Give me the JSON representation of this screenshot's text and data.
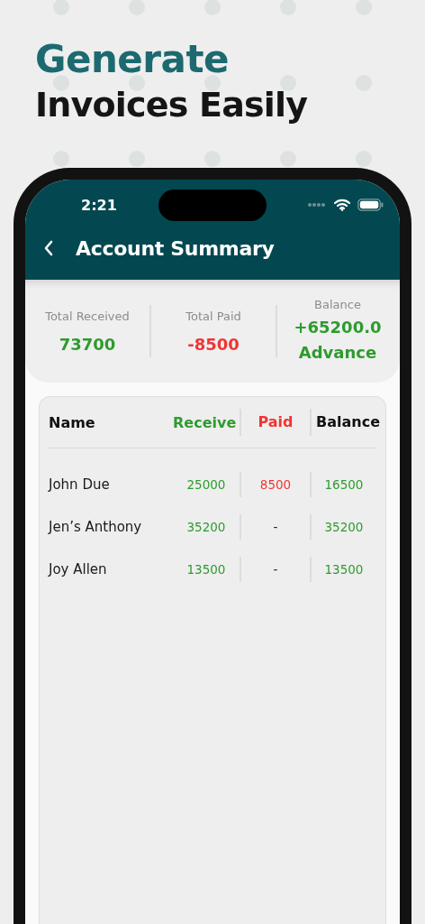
{
  "headline": {
    "accent": "Generate",
    "rest": "Invoices Easily"
  },
  "status_bar": {
    "time": "2:21"
  },
  "header": {
    "title": "Account Summary"
  },
  "summary": [
    {
      "label": "Total Received",
      "value": "73700",
      "color": "#2e9b2e"
    },
    {
      "label": "Total Paid",
      "value": "-8500",
      "color": "#f03535"
    },
    {
      "label": "Balance",
      "value": "+65200.0 Advance",
      "color": "#2e9b2e"
    }
  ],
  "table": {
    "columns": [
      {
        "label": "Name",
        "color": "#111111"
      },
      {
        "label": "Receive",
        "color": "#2e9b2e"
      },
      {
        "label": "Paid",
        "color": "#f03535"
      },
      {
        "label": "Balance",
        "color": "#111111"
      }
    ],
    "rows": [
      {
        "name": "John Due",
        "receive": "25000",
        "paid": "8500",
        "balance": "16500"
      },
      {
        "name": "Jen’s Anthony",
        "receive": "35200",
        "paid": "-",
        "balance": "35200"
      },
      {
        "name": "Joy Allen",
        "receive": "13500",
        "paid": "-",
        "balance": "13500"
      }
    ]
  }
}
